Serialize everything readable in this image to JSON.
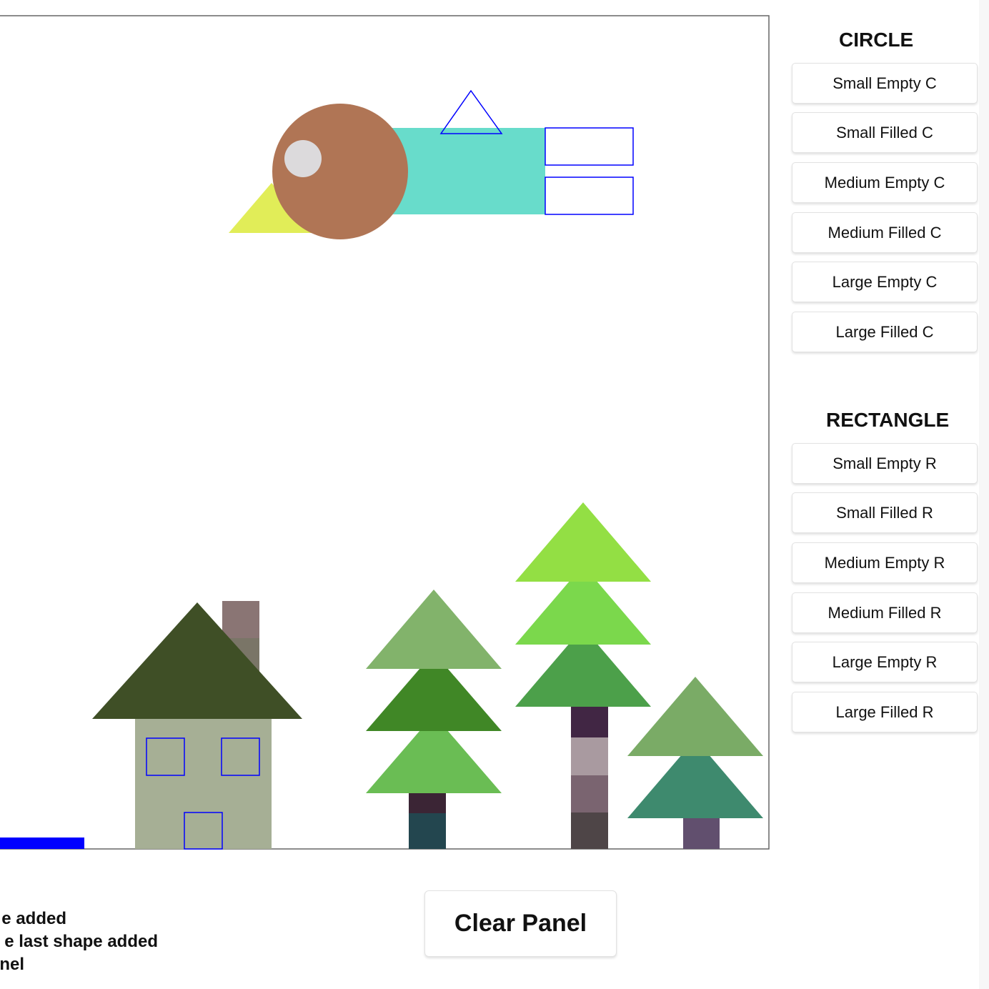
{
  "circle_panel": {
    "title": "CIRCLE",
    "buttons": [
      "Small Empty C",
      "Small Filled C",
      "Medium Empty C",
      "Medium Filled C",
      "Large Empty C",
      "Large Filled C"
    ]
  },
  "rectangle_panel": {
    "title": "RECTANGLE",
    "buttons": [
      "Small Empty R",
      "Small Filled R",
      "Medium Empty R",
      "Medium Filled R",
      "Large Empty R",
      "Large Filled R"
    ]
  },
  "clear_button": "Clear Panel",
  "help_lines": [
    "e added",
    "e last shape added",
    "nel"
  ],
  "colors": {
    "canvas_border": "#666666",
    "outline_blue": "#0000ff",
    "bird_body": "#68dccb",
    "bird_head": "#b07555",
    "bird_eye": "#dcdadc",
    "bird_beak": "#e1ed58",
    "house_roof": "#3f4f26",
    "house_wall": "#a6af95",
    "chimney_top": "#8a7574",
    "chimney_bottom": "#7a7567"
  }
}
